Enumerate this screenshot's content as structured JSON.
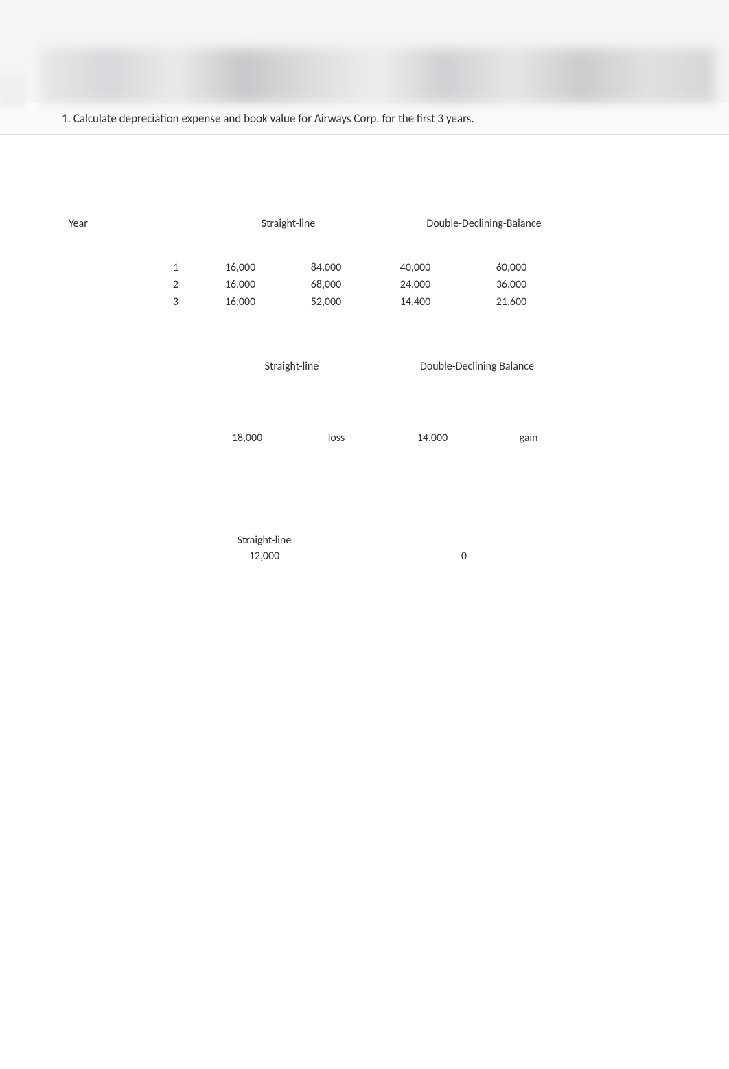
{
  "question": "1.  Calculate depreciation expense and book value for Airways Corp. for the first 3 years.",
  "table1": {
    "year_label": "Year",
    "headers": {
      "sl": "Straight-line",
      "ddb": "Double-Declining-Balance"
    },
    "rows": [
      {
        "year": "1",
        "sl_dep": "16,000",
        "sl_bv": "84,000",
        "ddb_dep": "40,000",
        "ddb_bv": "60,000"
      },
      {
        "year": "2",
        "sl_dep": "16,000",
        "sl_bv": "68,000",
        "ddb_dep": "24,000",
        "ddb_bv": "36,000"
      },
      {
        "year": "3",
        "sl_dep": "16,000",
        "sl_bv": "52,000",
        "ddb_dep": "14,400",
        "ddb_bv": "21,600"
      }
    ]
  },
  "table2": {
    "headers": {
      "sl": "Straight-line",
      "ddb": "Double-Declining Balance"
    },
    "row": {
      "sl_amount": "18,000",
      "sl_result": "loss",
      "ddb_amount": "14,000",
      "ddb_result": "gain"
    }
  },
  "table3": {
    "label": "Straight-line",
    "v1": "12,000",
    "v2": "0"
  }
}
